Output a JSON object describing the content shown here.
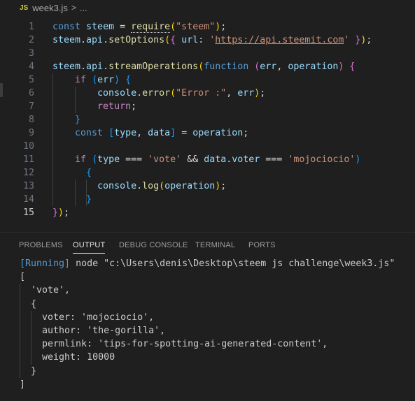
{
  "breadcrumb": {
    "badge": "JS",
    "file": "week3.js",
    "separator": ">",
    "more": "..."
  },
  "editor": {
    "active_line": 15,
    "line_numbers": [
      "1",
      "2",
      "3",
      "4",
      "5",
      "6",
      "7",
      "8",
      "9",
      "10",
      "11",
      "12",
      "13",
      "14",
      "15"
    ],
    "lines": [
      [
        [
          "kw",
          "const "
        ],
        [
          "var",
          "steem"
        ],
        [
          "pl",
          " = "
        ],
        [
          "fn squig",
          "require"
        ],
        [
          "br1",
          "("
        ],
        [
          "str",
          "\"steem\""
        ],
        [
          "br1",
          ")"
        ],
        [
          "pl",
          ";"
        ]
      ],
      [
        [
          "var",
          "steem"
        ],
        [
          "pl",
          "."
        ],
        [
          "var",
          "api"
        ],
        [
          "pl",
          "."
        ],
        [
          "fn",
          "setOptions"
        ],
        [
          "br1",
          "("
        ],
        [
          "br2",
          "{ "
        ],
        [
          "var",
          "url"
        ],
        [
          "pl",
          ": "
        ],
        [
          "str",
          "'"
        ],
        [
          "str url",
          "https://api.steemit.com"
        ],
        [
          "str",
          "'"
        ],
        [
          "br2",
          " }"
        ],
        [
          "br1",
          ")"
        ],
        [
          "pl",
          ";"
        ]
      ],
      [],
      [
        [
          "var",
          "steem"
        ],
        [
          "pl",
          "."
        ],
        [
          "var",
          "api"
        ],
        [
          "pl",
          "."
        ],
        [
          "fn",
          "streamOperations"
        ],
        [
          "br1",
          "("
        ],
        [
          "kw",
          "function "
        ],
        [
          "br2",
          "("
        ],
        [
          "var",
          "err"
        ],
        [
          "pl",
          ", "
        ],
        [
          "var",
          "operation"
        ],
        [
          "br2",
          ")"
        ],
        [
          "br2",
          " {"
        ]
      ],
      [
        [
          "pl",
          "    "
        ],
        [
          "ctl",
          "if "
        ],
        [
          "br3",
          "("
        ],
        [
          "var",
          "err"
        ],
        [
          "br3",
          ")"
        ],
        [
          "br3",
          " {"
        ]
      ],
      [
        [
          "pl",
          "        "
        ],
        [
          "var",
          "console"
        ],
        [
          "pl",
          "."
        ],
        [
          "fn",
          "error"
        ],
        [
          "br1",
          "("
        ],
        [
          "str",
          "\"Error :\""
        ],
        [
          "pl",
          ", "
        ],
        [
          "var",
          "err"
        ],
        [
          "br1",
          ")"
        ],
        [
          "pl",
          ";"
        ]
      ],
      [
        [
          "pl",
          "        "
        ],
        [
          "ctl",
          "return"
        ],
        [
          "pl",
          ";"
        ]
      ],
      [
        [
          "pl",
          "    "
        ],
        [
          "br3",
          "}"
        ]
      ],
      [
        [
          "pl",
          "    "
        ],
        [
          "kw",
          "const "
        ],
        [
          "br3",
          "["
        ],
        [
          "var",
          "type"
        ],
        [
          "pl",
          ", "
        ],
        [
          "var",
          "data"
        ],
        [
          "br3",
          "]"
        ],
        [
          "pl",
          " = "
        ],
        [
          "var",
          "operation"
        ],
        [
          "pl",
          ";"
        ]
      ],
      [],
      [
        [
          "pl",
          "    "
        ],
        [
          "ctl",
          "if "
        ],
        [
          "br3",
          "("
        ],
        [
          "var",
          "type"
        ],
        [
          "pl",
          " === "
        ],
        [
          "str",
          "'vote'"
        ],
        [
          "pl",
          " && "
        ],
        [
          "var",
          "data"
        ],
        [
          "pl",
          "."
        ],
        [
          "var",
          "voter"
        ],
        [
          "pl",
          " === "
        ],
        [
          "str",
          "'mojociocio'"
        ],
        [
          "br3",
          ")"
        ]
      ],
      [
        [
          "pl",
          "      "
        ],
        [
          "br3",
          "{"
        ]
      ],
      [
        [
          "pl",
          "        "
        ],
        [
          "var",
          "console"
        ],
        [
          "pl",
          "."
        ],
        [
          "fn",
          "log"
        ],
        [
          "br1",
          "("
        ],
        [
          "var",
          "operation"
        ],
        [
          "br1",
          ")"
        ],
        [
          "pl",
          ";"
        ]
      ],
      [
        [
          "pl",
          "      "
        ],
        [
          "br3",
          "}"
        ]
      ],
      [
        [
          "br2",
          "}"
        ],
        [
          "br1",
          ")"
        ],
        [
          "pl",
          ";"
        ]
      ]
    ]
  },
  "panel": {
    "tabs": [
      {
        "label": "PROBLEMS",
        "active": false
      },
      {
        "label": "OUTPUT",
        "active": true
      },
      {
        "label": "DEBUG CONSOLE",
        "active": false
      },
      {
        "label": "TERMINAL",
        "active": false
      },
      {
        "label": "PORTS",
        "active": false
      }
    ],
    "output": {
      "running_tag": "[Running]",
      "command": " node \"c:\\Users\\denis\\Desktop\\steem js challenge\\week3.js\"",
      "lines": [
        "[",
        "  'vote',",
        "  {",
        "    voter: 'mojociocio',",
        "    author: 'the-gorilla',",
        "    permlink: 'tips-for-spotting-ai-generated-content',",
        "    weight: 10000",
        "  }",
        "]"
      ]
    }
  }
}
